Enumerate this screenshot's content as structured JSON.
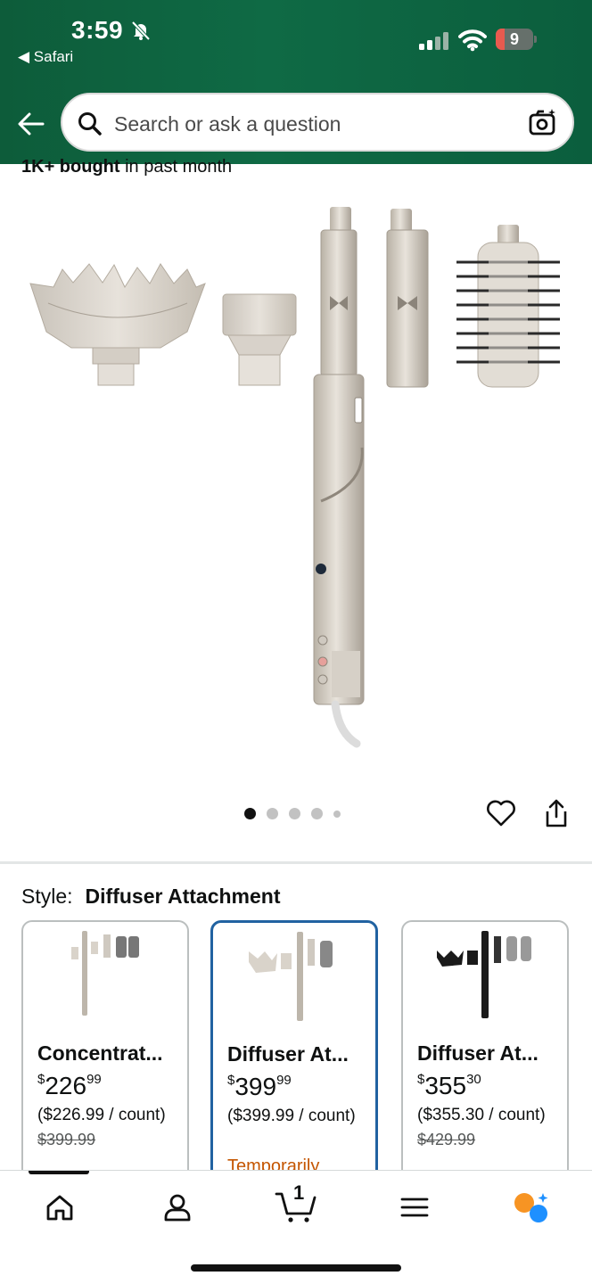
{
  "status_bar": {
    "time": "3:59",
    "back_app": "◀ Safari",
    "battery": "9"
  },
  "header": {
    "search_placeholder": "Search or ask a question"
  },
  "product": {
    "bought_bold": "1K+ bought",
    "bought_rest": " in past month",
    "image_dots": {
      "total": 5,
      "active_index": 0
    }
  },
  "style": {
    "label": "Style:",
    "value": "Diffuser Attachment"
  },
  "cards": [
    {
      "name": "Concentrat...",
      "price_whole": "226",
      "price_frac": "99",
      "unit": "($226.99 / count)",
      "list": "$399.99",
      "availability": "",
      "selected": false
    },
    {
      "name": "Diffuser At...",
      "price_whole": "399",
      "price_frac": "99",
      "unit": "($399.99 / count)",
      "list": "",
      "availability": "Temporarily",
      "selected": true
    },
    {
      "name": "Diffuser At...",
      "price_whole": "355",
      "price_frac": "30",
      "unit": "($355.30 / count)",
      "list": "$429.99",
      "availability": "",
      "selected": false
    }
  ],
  "bottom_nav": {
    "cart_count": "1",
    "items": [
      "home-icon",
      "account-icon",
      "cart-icon",
      "menu-icon",
      "rufus-icon"
    ]
  },
  "colors": {
    "header_green": "#0f6a45",
    "selected_border": "#2162a1",
    "availability": "#c45500",
    "assistant_orange": "#f79423",
    "assistant_blue": "#1e90ff"
  }
}
